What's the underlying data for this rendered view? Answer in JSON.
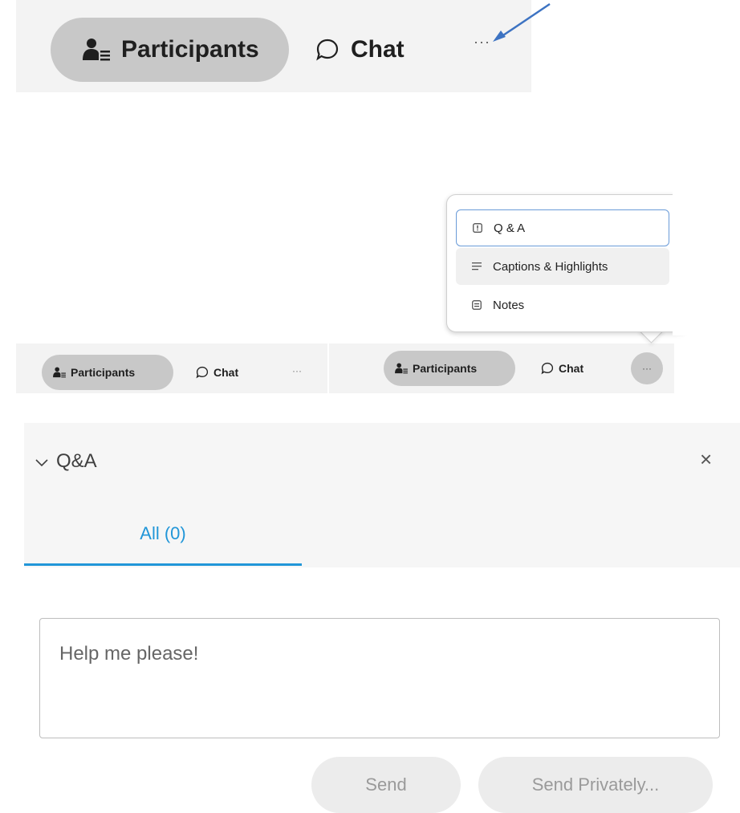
{
  "toolbar_large": {
    "participants_label": "Participants",
    "chat_label": "Chat",
    "more_label": "···"
  },
  "toolbar_small_left": {
    "participants_label": "Participants",
    "chat_label": "Chat",
    "more_label": "···"
  },
  "toolbar_small_right": {
    "participants_label": "Participants",
    "chat_label": "Chat",
    "more_label": "···"
  },
  "more_menu": {
    "items": [
      {
        "label": "Q & A",
        "icon": "qa-icon"
      },
      {
        "label": "Captions & Highlights",
        "icon": "captions-icon"
      },
      {
        "label": "Notes",
        "icon": "notes-icon"
      }
    ]
  },
  "qa_panel": {
    "title": "Q&A",
    "close_label": "×",
    "tab_all": "All (0)",
    "input_text": "Help me please!",
    "send_label": "Send",
    "send_private_label": "Send Privately..."
  },
  "colors": {
    "accent": "#2196d8",
    "annotation_arrow": "#3d73c2",
    "pill_bg": "#c8c8c8",
    "toolbar_bg": "#f3f3f3"
  }
}
